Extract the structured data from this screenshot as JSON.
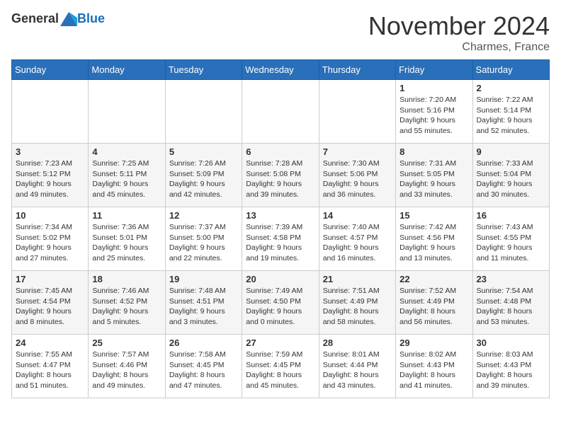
{
  "header": {
    "logo_general": "General",
    "logo_blue": "Blue",
    "month_title": "November 2024",
    "location": "Charmes, France"
  },
  "weekdays": [
    "Sunday",
    "Monday",
    "Tuesday",
    "Wednesday",
    "Thursday",
    "Friday",
    "Saturday"
  ],
  "weeks": [
    [
      {
        "day": "",
        "info": ""
      },
      {
        "day": "",
        "info": ""
      },
      {
        "day": "",
        "info": ""
      },
      {
        "day": "",
        "info": ""
      },
      {
        "day": "",
        "info": ""
      },
      {
        "day": "1",
        "info": "Sunrise: 7:20 AM\nSunset: 5:16 PM\nDaylight: 9 hours\nand 55 minutes."
      },
      {
        "day": "2",
        "info": "Sunrise: 7:22 AM\nSunset: 5:14 PM\nDaylight: 9 hours\nand 52 minutes."
      }
    ],
    [
      {
        "day": "3",
        "info": "Sunrise: 7:23 AM\nSunset: 5:12 PM\nDaylight: 9 hours\nand 49 minutes."
      },
      {
        "day": "4",
        "info": "Sunrise: 7:25 AM\nSunset: 5:11 PM\nDaylight: 9 hours\nand 45 minutes."
      },
      {
        "day": "5",
        "info": "Sunrise: 7:26 AM\nSunset: 5:09 PM\nDaylight: 9 hours\nand 42 minutes."
      },
      {
        "day": "6",
        "info": "Sunrise: 7:28 AM\nSunset: 5:08 PM\nDaylight: 9 hours\nand 39 minutes."
      },
      {
        "day": "7",
        "info": "Sunrise: 7:30 AM\nSunset: 5:06 PM\nDaylight: 9 hours\nand 36 minutes."
      },
      {
        "day": "8",
        "info": "Sunrise: 7:31 AM\nSunset: 5:05 PM\nDaylight: 9 hours\nand 33 minutes."
      },
      {
        "day": "9",
        "info": "Sunrise: 7:33 AM\nSunset: 5:04 PM\nDaylight: 9 hours\nand 30 minutes."
      }
    ],
    [
      {
        "day": "10",
        "info": "Sunrise: 7:34 AM\nSunset: 5:02 PM\nDaylight: 9 hours\nand 27 minutes."
      },
      {
        "day": "11",
        "info": "Sunrise: 7:36 AM\nSunset: 5:01 PM\nDaylight: 9 hours\nand 25 minutes."
      },
      {
        "day": "12",
        "info": "Sunrise: 7:37 AM\nSunset: 5:00 PM\nDaylight: 9 hours\nand 22 minutes."
      },
      {
        "day": "13",
        "info": "Sunrise: 7:39 AM\nSunset: 4:58 PM\nDaylight: 9 hours\nand 19 minutes."
      },
      {
        "day": "14",
        "info": "Sunrise: 7:40 AM\nSunset: 4:57 PM\nDaylight: 9 hours\nand 16 minutes."
      },
      {
        "day": "15",
        "info": "Sunrise: 7:42 AM\nSunset: 4:56 PM\nDaylight: 9 hours\nand 13 minutes."
      },
      {
        "day": "16",
        "info": "Sunrise: 7:43 AM\nSunset: 4:55 PM\nDaylight: 9 hours\nand 11 minutes."
      }
    ],
    [
      {
        "day": "17",
        "info": "Sunrise: 7:45 AM\nSunset: 4:54 PM\nDaylight: 9 hours\nand 8 minutes."
      },
      {
        "day": "18",
        "info": "Sunrise: 7:46 AM\nSunset: 4:52 PM\nDaylight: 9 hours\nand 5 minutes."
      },
      {
        "day": "19",
        "info": "Sunrise: 7:48 AM\nSunset: 4:51 PM\nDaylight: 9 hours\nand 3 minutes."
      },
      {
        "day": "20",
        "info": "Sunrise: 7:49 AM\nSunset: 4:50 PM\nDaylight: 9 hours\nand 0 minutes."
      },
      {
        "day": "21",
        "info": "Sunrise: 7:51 AM\nSunset: 4:49 PM\nDaylight: 8 hours\nand 58 minutes."
      },
      {
        "day": "22",
        "info": "Sunrise: 7:52 AM\nSunset: 4:49 PM\nDaylight: 8 hours\nand 56 minutes."
      },
      {
        "day": "23",
        "info": "Sunrise: 7:54 AM\nSunset: 4:48 PM\nDaylight: 8 hours\nand 53 minutes."
      }
    ],
    [
      {
        "day": "24",
        "info": "Sunrise: 7:55 AM\nSunset: 4:47 PM\nDaylight: 8 hours\nand 51 minutes."
      },
      {
        "day": "25",
        "info": "Sunrise: 7:57 AM\nSunset: 4:46 PM\nDaylight: 8 hours\nand 49 minutes."
      },
      {
        "day": "26",
        "info": "Sunrise: 7:58 AM\nSunset: 4:45 PM\nDaylight: 8 hours\nand 47 minutes."
      },
      {
        "day": "27",
        "info": "Sunrise: 7:59 AM\nSunset: 4:45 PM\nDaylight: 8 hours\nand 45 minutes."
      },
      {
        "day": "28",
        "info": "Sunrise: 8:01 AM\nSunset: 4:44 PM\nDaylight: 8 hours\nand 43 minutes."
      },
      {
        "day": "29",
        "info": "Sunrise: 8:02 AM\nSunset: 4:43 PM\nDaylight: 8 hours\nand 41 minutes."
      },
      {
        "day": "30",
        "info": "Sunrise: 8:03 AM\nSunset: 4:43 PM\nDaylight: 8 hours\nand 39 minutes."
      }
    ]
  ]
}
